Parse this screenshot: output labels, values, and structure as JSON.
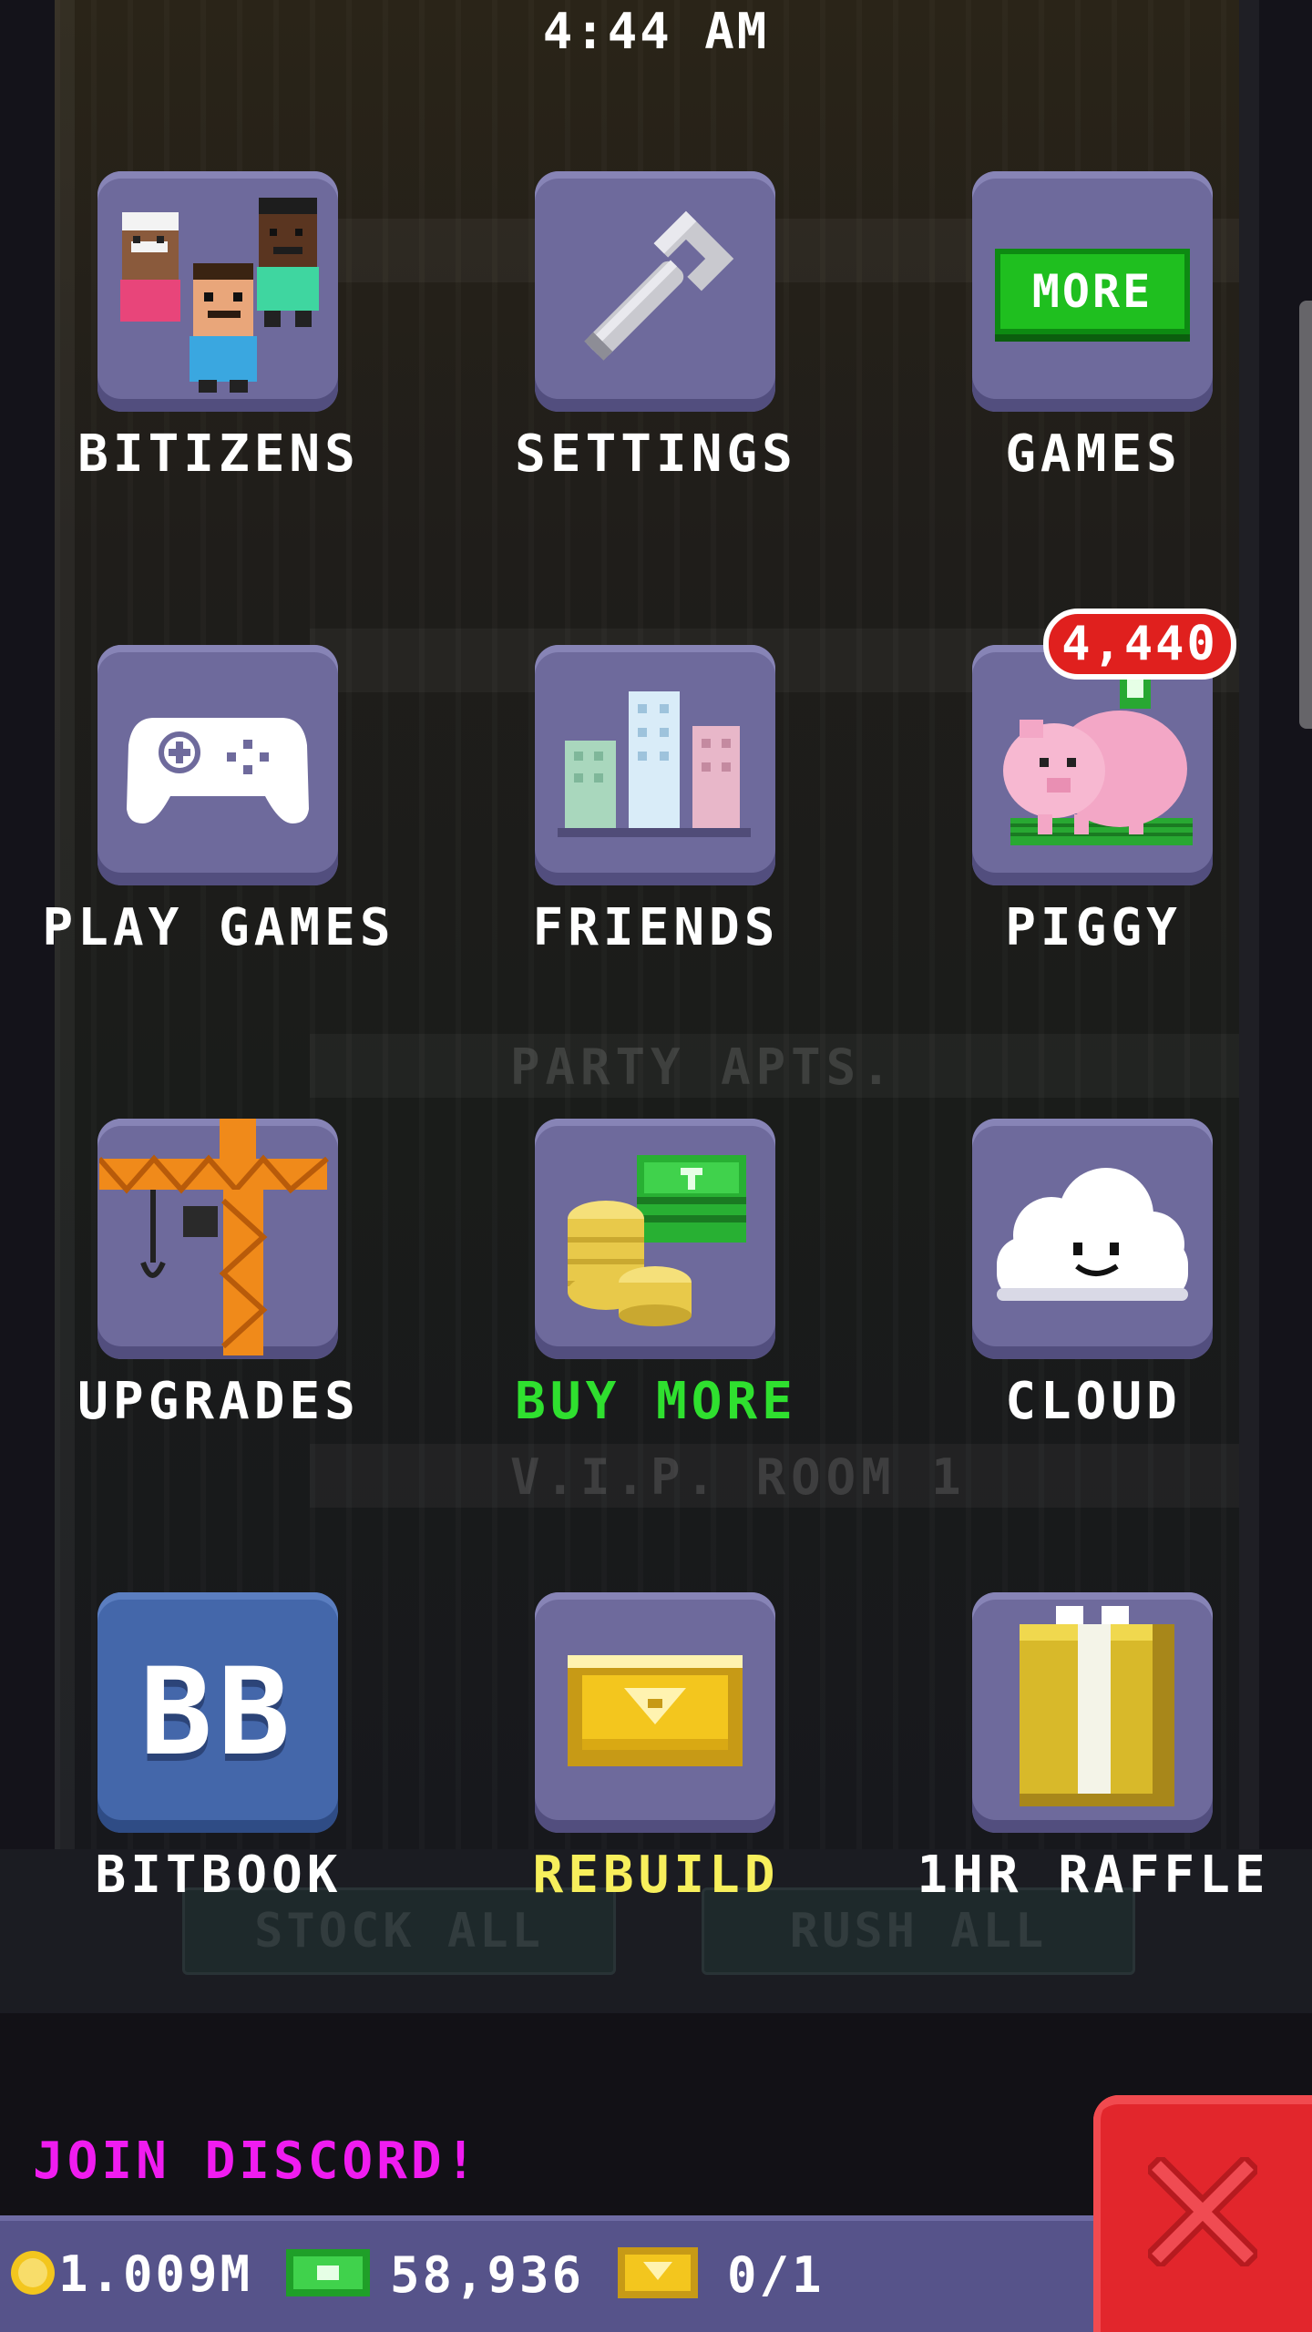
{
  "status": {
    "time": "4:44 AM"
  },
  "menu": [
    {
      "id": "bitizens",
      "label": "BITIZENS",
      "icon": "bitizens-people-icon"
    },
    {
      "id": "settings",
      "label": "SETTINGS",
      "icon": "wrench-icon"
    },
    {
      "id": "games",
      "label": "GAMES",
      "icon": "more-games-icon",
      "icon_text": "MORE"
    },
    {
      "id": "play-games",
      "label": "PLAY GAMES",
      "icon": "gamepad-icon"
    },
    {
      "id": "friends",
      "label": "FRIENDS",
      "icon": "buildings-icon"
    },
    {
      "id": "piggy",
      "label": "PIGGY",
      "icon": "piggy-bank-icon",
      "badge": "4,440"
    },
    {
      "id": "upgrades",
      "label": "UPGRADES",
      "icon": "crane-icon"
    },
    {
      "id": "buy-more",
      "label": "BUY MORE",
      "icon": "coins-and-bux-icon"
    },
    {
      "id": "cloud",
      "label": "CLOUD",
      "icon": "cloud-icon"
    },
    {
      "id": "bitbook",
      "label": "BITBOOK",
      "icon": "bitbook-icon",
      "icon_text": "BB"
    },
    {
      "id": "rebuild",
      "label": "REBUILD",
      "icon": "golden-ticket-icon"
    },
    {
      "id": "raffle",
      "label": "1HR RAFFLE",
      "icon": "gift-box-icon"
    }
  ],
  "footer": {
    "discord": "JOIN DISCORD!",
    "coins": "1.009M",
    "bux": "58,936",
    "tickets": "0/1"
  },
  "background": {
    "floors": [
      "PARTY APTS.",
      "V.I.P. ROOM 1"
    ],
    "buttons": [
      "STOCK ALL",
      "RUSH ALL"
    ]
  },
  "colors": {
    "tile": "#6e6a9c",
    "bitbook_tile": "#4467aa",
    "buy_more_label": "#2fe02f",
    "rebuild_label": "#f7ef5c",
    "discord": "#f01cf0",
    "close": "#e2262c",
    "badge": "#e0201e"
  }
}
